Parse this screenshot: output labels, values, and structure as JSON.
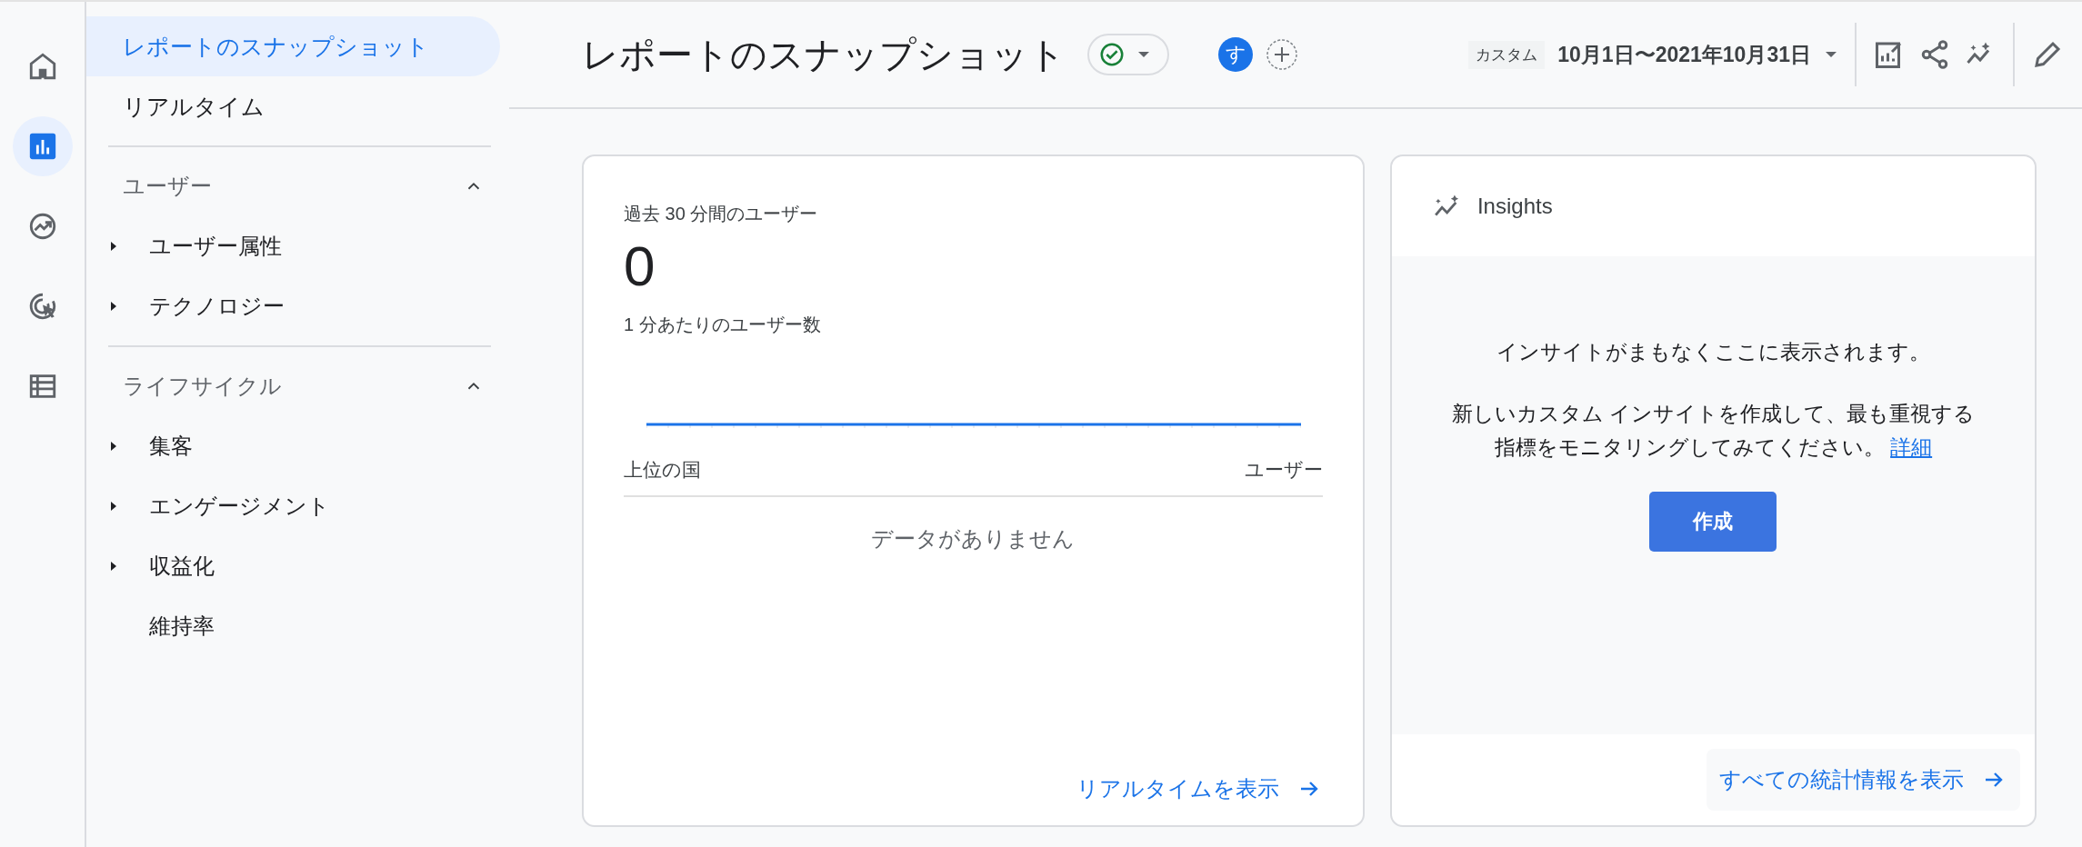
{
  "rail": [
    {
      "selected": false
    },
    {
      "selected": true
    },
    {
      "selected": false
    },
    {
      "selected": false
    },
    {
      "selected": false
    }
  ],
  "nav": {
    "items": [
      {
        "label": "レポートのスナップショット",
        "selected": true
      },
      {
        "label": "リアルタイム",
        "selected": false
      }
    ],
    "sections": [
      {
        "title": "ユーザー",
        "expanded": true,
        "items": [
          {
            "label": "ユーザー属性",
            "expandable": true,
            "selected": false
          },
          {
            "label": "テクノロジー",
            "expandable": true,
            "selected": false
          }
        ]
      },
      {
        "title": "ライフサイクル",
        "expanded": true,
        "items": [
          {
            "label": "集客",
            "expandable": true,
            "selected": false
          },
          {
            "label": "エンゲージメント",
            "expandable": true,
            "selected": false
          },
          {
            "label": "収益化",
            "expandable": true,
            "selected": false
          },
          {
            "label": "維持率",
            "expandable": false,
            "selected": false
          }
        ]
      }
    ]
  },
  "header": {
    "title": "レポートのスナップショット",
    "avatar": "す",
    "date_badge": "カスタム",
    "date_range": "10月1日〜2021年10月31日"
  },
  "realtime_card": {
    "label": "過去 30 分間のユーザー",
    "value": "0",
    "chart_label": "1 分あたりのユーザー数",
    "columns": [
      "上位の国",
      "ユーザー"
    ],
    "empty": "データがありません",
    "link": "リアルタイムを表示"
  },
  "insights_card": {
    "title": "Insights",
    "headline": "インサイトがまもなくここに表示されます。",
    "body": "新しいカスタム インサイトを作成して、最も重視する指標をモニタリングしてみてください。",
    "link": "詳細",
    "button": "作成",
    "footer_link": "すべての統計情報を表示"
  }
}
